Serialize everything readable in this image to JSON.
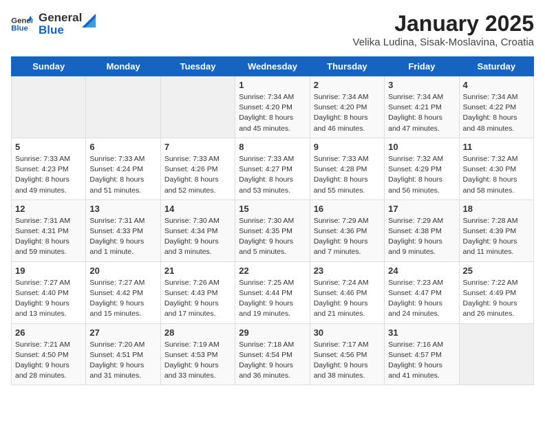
{
  "header": {
    "logo_general": "General",
    "logo_blue": "Blue",
    "month_title": "January 2025",
    "location": "Velika Ludina, Sisak-Moslavina, Croatia"
  },
  "days_of_week": [
    "Sunday",
    "Monday",
    "Tuesday",
    "Wednesday",
    "Thursday",
    "Friday",
    "Saturday"
  ],
  "weeks": [
    [
      {
        "day": "",
        "info": ""
      },
      {
        "day": "",
        "info": ""
      },
      {
        "day": "",
        "info": ""
      },
      {
        "day": "1",
        "info": "Sunrise: 7:34 AM\nSunset: 4:20 PM\nDaylight: 8 hours\nand 45 minutes."
      },
      {
        "day": "2",
        "info": "Sunrise: 7:34 AM\nSunset: 4:20 PM\nDaylight: 8 hours\nand 46 minutes."
      },
      {
        "day": "3",
        "info": "Sunrise: 7:34 AM\nSunset: 4:21 PM\nDaylight: 8 hours\nand 47 minutes."
      },
      {
        "day": "4",
        "info": "Sunrise: 7:34 AM\nSunset: 4:22 PM\nDaylight: 8 hours\nand 48 minutes."
      }
    ],
    [
      {
        "day": "5",
        "info": "Sunrise: 7:33 AM\nSunset: 4:23 PM\nDaylight: 8 hours\nand 49 minutes."
      },
      {
        "day": "6",
        "info": "Sunrise: 7:33 AM\nSunset: 4:24 PM\nDaylight: 8 hours\nand 51 minutes."
      },
      {
        "day": "7",
        "info": "Sunrise: 7:33 AM\nSunset: 4:26 PM\nDaylight: 8 hours\nand 52 minutes."
      },
      {
        "day": "8",
        "info": "Sunrise: 7:33 AM\nSunset: 4:27 PM\nDaylight: 8 hours\nand 53 minutes."
      },
      {
        "day": "9",
        "info": "Sunrise: 7:33 AM\nSunset: 4:28 PM\nDaylight: 8 hours\nand 55 minutes."
      },
      {
        "day": "10",
        "info": "Sunrise: 7:32 AM\nSunset: 4:29 PM\nDaylight: 8 hours\nand 56 minutes."
      },
      {
        "day": "11",
        "info": "Sunrise: 7:32 AM\nSunset: 4:30 PM\nDaylight: 8 hours\nand 58 minutes."
      }
    ],
    [
      {
        "day": "12",
        "info": "Sunrise: 7:31 AM\nSunset: 4:31 PM\nDaylight: 8 hours\nand 59 minutes."
      },
      {
        "day": "13",
        "info": "Sunrise: 7:31 AM\nSunset: 4:33 PM\nDaylight: 9 hours\nand 1 minute."
      },
      {
        "day": "14",
        "info": "Sunrise: 7:30 AM\nSunset: 4:34 PM\nDaylight: 9 hours\nand 3 minutes."
      },
      {
        "day": "15",
        "info": "Sunrise: 7:30 AM\nSunset: 4:35 PM\nDaylight: 9 hours\nand 5 minutes."
      },
      {
        "day": "16",
        "info": "Sunrise: 7:29 AM\nSunset: 4:36 PM\nDaylight: 9 hours\nand 7 minutes."
      },
      {
        "day": "17",
        "info": "Sunrise: 7:29 AM\nSunset: 4:38 PM\nDaylight: 9 hours\nand 9 minutes."
      },
      {
        "day": "18",
        "info": "Sunrise: 7:28 AM\nSunset: 4:39 PM\nDaylight: 9 hours\nand 11 minutes."
      }
    ],
    [
      {
        "day": "19",
        "info": "Sunrise: 7:27 AM\nSunset: 4:40 PM\nDaylight: 9 hours\nand 13 minutes."
      },
      {
        "day": "20",
        "info": "Sunrise: 7:27 AM\nSunset: 4:42 PM\nDaylight: 9 hours\nand 15 minutes."
      },
      {
        "day": "21",
        "info": "Sunrise: 7:26 AM\nSunset: 4:43 PM\nDaylight: 9 hours\nand 17 minutes."
      },
      {
        "day": "22",
        "info": "Sunrise: 7:25 AM\nSunset: 4:44 PM\nDaylight: 9 hours\nand 19 minutes."
      },
      {
        "day": "23",
        "info": "Sunrise: 7:24 AM\nSunset: 4:46 PM\nDaylight: 9 hours\nand 21 minutes."
      },
      {
        "day": "24",
        "info": "Sunrise: 7:23 AM\nSunset: 4:47 PM\nDaylight: 9 hours\nand 24 minutes."
      },
      {
        "day": "25",
        "info": "Sunrise: 7:22 AM\nSunset: 4:49 PM\nDaylight: 9 hours\nand 26 minutes."
      }
    ],
    [
      {
        "day": "26",
        "info": "Sunrise: 7:21 AM\nSunset: 4:50 PM\nDaylight: 9 hours\nand 28 minutes."
      },
      {
        "day": "27",
        "info": "Sunrise: 7:20 AM\nSunset: 4:51 PM\nDaylight: 9 hours\nand 31 minutes."
      },
      {
        "day": "28",
        "info": "Sunrise: 7:19 AM\nSunset: 4:53 PM\nDaylight: 9 hours\nand 33 minutes."
      },
      {
        "day": "29",
        "info": "Sunrise: 7:18 AM\nSunset: 4:54 PM\nDaylight: 9 hours\nand 36 minutes."
      },
      {
        "day": "30",
        "info": "Sunrise: 7:17 AM\nSunset: 4:56 PM\nDaylight: 9 hours\nand 38 minutes."
      },
      {
        "day": "31",
        "info": "Sunrise: 7:16 AM\nSunset: 4:57 PM\nDaylight: 9 hours\nand 41 minutes."
      },
      {
        "day": "",
        "info": ""
      }
    ]
  ]
}
